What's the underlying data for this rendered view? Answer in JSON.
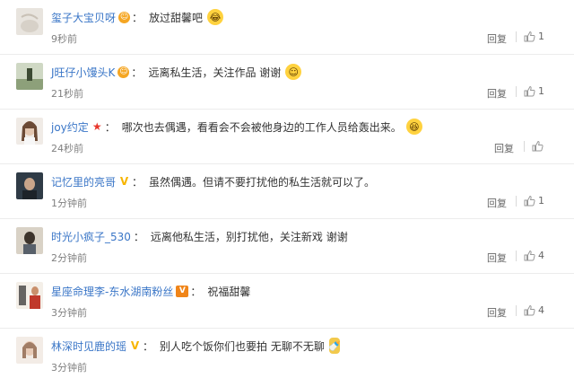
{
  "comments": [
    {
      "user": "玺子大宝贝呀",
      "badge": "smile",
      "text": "放过甜馨吧",
      "emoji": "laugh-tears",
      "time": "9秒前",
      "reply": "回复",
      "likes": "1"
    },
    {
      "user": "J旺仔小馒头K",
      "badge": "smile",
      "text": "远离私生活，关注作品 谢谢",
      "emoji": "smile",
      "time": "21秒前",
      "reply": "回复",
      "likes": "1"
    },
    {
      "user": "joy约定",
      "badge": "star",
      "text": "哪次也去偶遇，看看会不会被他身边的工作人员给轰出来。",
      "emoji": "laugh",
      "time": "24秒前",
      "reply": "回复",
      "likes": ""
    },
    {
      "user": "记忆里的亮哥",
      "badge": "verified",
      "text": "虽然偶遇。但请不要打扰他的私生活就可以了。",
      "emoji": "",
      "time": "1分钟前",
      "reply": "回复",
      "likes": "1"
    },
    {
      "user": "时光小疯子_530",
      "badge": "",
      "text": "远离他私生活，别打扰他，关注新戏 谢谢",
      "emoji": "",
      "time": "2分钟前",
      "reply": "回复",
      "likes": "4"
    },
    {
      "user": "星座命理李-东水湖南粉丝",
      "badge": "vip",
      "text": "祝福甜馨",
      "emoji": "",
      "time": "3分钟前",
      "reply": "回复",
      "likes": "4"
    },
    {
      "user": "林深时见鹿的瑶",
      "badge": "verified",
      "text": "别人吃个饭你们也要拍 无聊不无聊",
      "emoji": "bottle",
      "time": "3分钟前",
      "reply": "",
      "likes": ""
    }
  ],
  "colors": {
    "username": "#3a76c7",
    "like_icon": "#999999",
    "text": "#333333",
    "meta": "#808080"
  },
  "icons": {
    "like": "thumbs-up-icon",
    "verified": "verified-v-icon",
    "vip": "vip-badge-icon",
    "star": "star-badge-icon"
  }
}
